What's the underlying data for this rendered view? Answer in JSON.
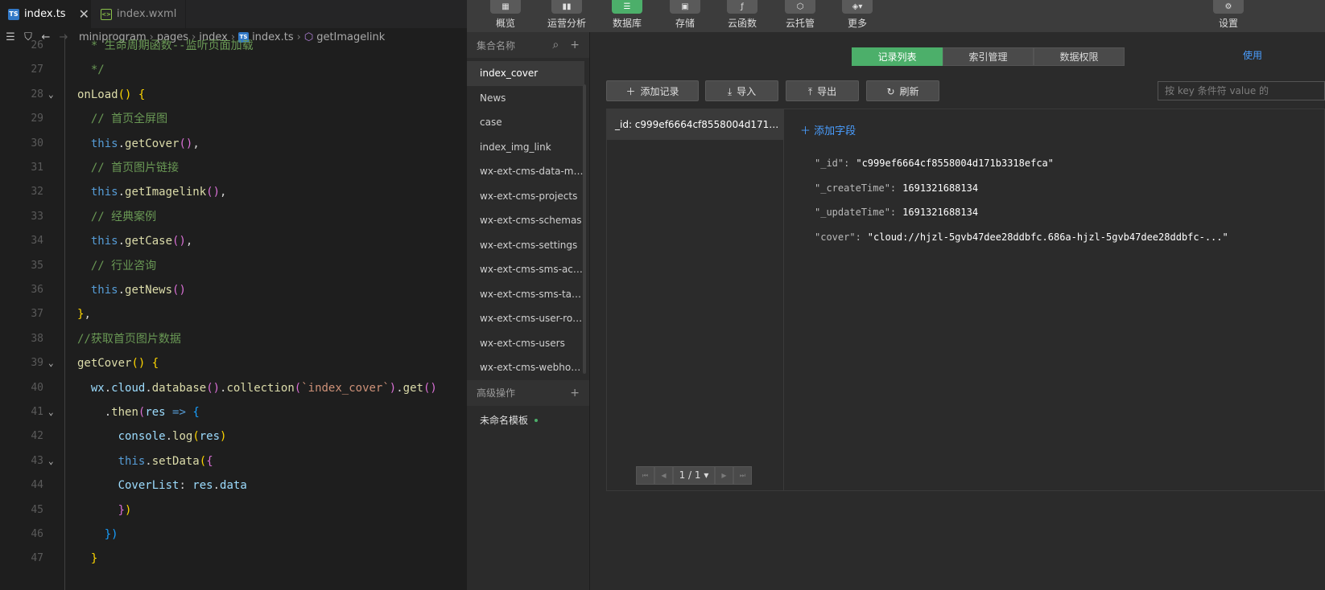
{
  "editor": {
    "tabs": [
      {
        "label": "index.ts",
        "close": "✕",
        "badge": "TS"
      },
      {
        "label": "index.wxml",
        "badge": "<>"
      }
    ],
    "breadcrumb": {
      "items": [
        "miniprogram",
        "pages",
        "index",
        "index.ts",
        "getImagelink"
      ]
    },
    "lines": [
      {
        "n": "26",
        "t": [
          [
            "  * 生命周期函数--监听页面加载",
            "cm"
          ]
        ]
      },
      {
        "n": "27",
        "t": [
          [
            "  */",
            "cm"
          ]
        ]
      },
      {
        "n": "28",
        "t": [
          [
            "onLoad",
            "fn"
          ],
          [
            "() ",
            "br1"
          ],
          [
            "{",
            "br1"
          ]
        ]
      },
      {
        "n": "29",
        "t": [
          [
            "  // 首页全屏图",
            "cm"
          ]
        ]
      },
      {
        "n": "30",
        "t": [
          [
            "  this",
            "kw"
          ],
          [
            ".",
            "pu"
          ],
          [
            "getCover",
            "fn"
          ],
          [
            "()",
            "br2"
          ],
          [
            ",",
            "pu"
          ]
        ]
      },
      {
        "n": "31",
        "t": [
          [
            "  // 首页图片链接",
            "cm"
          ]
        ]
      },
      {
        "n": "32",
        "t": [
          [
            "  this",
            "kw"
          ],
          [
            ".",
            "pu"
          ],
          [
            "getImagelink",
            "fn"
          ],
          [
            "()",
            "br2"
          ],
          [
            ",",
            "pu"
          ]
        ]
      },
      {
        "n": "33",
        "t": [
          [
            "  // 经典案例",
            "cm"
          ]
        ]
      },
      {
        "n": "34",
        "t": [
          [
            "  this",
            "kw"
          ],
          [
            ".",
            "pu"
          ],
          [
            "getCase",
            "fn"
          ],
          [
            "()",
            "br2"
          ],
          [
            ",",
            "pu"
          ]
        ]
      },
      {
        "n": "35",
        "t": [
          [
            "  // 行业咨询",
            "cm"
          ]
        ]
      },
      {
        "n": "36",
        "t": [
          [
            "  this",
            "kw"
          ],
          [
            ".",
            "pu"
          ],
          [
            "getNews",
            "fn"
          ],
          [
            "()",
            "br2"
          ]
        ]
      },
      {
        "n": "37",
        "t": [
          [
            "}",
            "br1"
          ],
          [
            ",",
            "pu"
          ]
        ]
      },
      {
        "n": "38",
        "t": [
          [
            "//获取首页图片数据",
            "cm"
          ]
        ]
      },
      {
        "n": "39",
        "t": [
          [
            "getCover",
            "fn"
          ],
          [
            "() ",
            "br1"
          ],
          [
            "{",
            "br1"
          ]
        ]
      },
      {
        "n": "40",
        "t": [
          [
            "  wx",
            "pr"
          ],
          [
            ".",
            "pu"
          ],
          [
            "cloud",
            "pr"
          ],
          [
            ".",
            "pu"
          ],
          [
            "database",
            "fn"
          ],
          [
            "()",
            "br2"
          ],
          [
            ".",
            "pu"
          ],
          [
            "collection",
            "fn"
          ],
          [
            "(",
            "br2"
          ],
          [
            "`index_cover`",
            "str"
          ],
          [
            ")",
            "br2"
          ],
          [
            ".",
            "pu"
          ],
          [
            "get",
            "fn"
          ],
          [
            "()",
            "br2"
          ]
        ]
      },
      {
        "n": "41",
        "t": [
          [
            "    .",
            "pu"
          ],
          [
            "then",
            "fn"
          ],
          [
            "(",
            "br2"
          ],
          [
            "res",
            "pr"
          ],
          [
            " => ",
            "kw"
          ],
          [
            "{",
            "br3"
          ]
        ]
      },
      {
        "n": "42",
        "t": [
          [
            "      console",
            "pr"
          ],
          [
            ".",
            "pu"
          ],
          [
            "log",
            "fn"
          ],
          [
            "(",
            "br1"
          ],
          [
            "res",
            "pr"
          ],
          [
            ")",
            "br1"
          ]
        ]
      },
      {
        "n": "43",
        "t": [
          [
            "      this",
            "kw"
          ],
          [
            ".",
            "pu"
          ],
          [
            "setData",
            "fn"
          ],
          [
            "(",
            "br1"
          ],
          [
            "{",
            "br2"
          ]
        ]
      },
      {
        "n": "44",
        "t": [
          [
            "      CoverList",
            "pr"
          ],
          [
            ": ",
            "pu"
          ],
          [
            "res",
            "pr"
          ],
          [
            ".",
            "pu"
          ],
          [
            "data",
            "pr"
          ]
        ]
      },
      {
        "n": "45",
        "t": [
          [
            "      }",
            "br2"
          ],
          [
            ")",
            "br1"
          ]
        ]
      },
      {
        "n": "46",
        "t": [
          [
            "    })",
            "br3"
          ]
        ]
      },
      {
        "n": "47",
        "t": [
          [
            "  }",
            "br1"
          ]
        ]
      }
    ]
  },
  "db": {
    "topbar": [
      {
        "label": "概览",
        "icon": "▦"
      },
      {
        "label": "运营分析",
        "icon": "▮▮"
      },
      {
        "label": "数据库",
        "icon": "☰"
      },
      {
        "label": "存储",
        "icon": "▣"
      },
      {
        "label": "云函数",
        "icon": "ƒ"
      },
      {
        "label": "云托管",
        "icon": "⬡"
      },
      {
        "label": "更多",
        "icon": "◈▾"
      },
      {
        "label": "设置",
        "icon": "⚙"
      }
    ],
    "sidebar": {
      "header": "集合名称",
      "collections": [
        "index_cover",
        "News",
        "case",
        "index_img_link",
        "wx-ext-cms-data-mig...",
        "wx-ext-cms-projects",
        "wx-ext-cms-schemas",
        "wx-ext-cms-settings",
        "wx-ext-cms-sms-activ...",
        "wx-ext-cms-sms-tasks",
        "wx-ext-cms-user-roles",
        "wx-ext-cms-users",
        "wx-ext-cms-webhook..."
      ],
      "advanced_header": "高级操作",
      "templates": [
        "未命名模板"
      ]
    },
    "tabs": [
      "记录列表",
      "索引管理",
      "数据权限"
    ],
    "use_link": "使用",
    "actions": {
      "add": "添加记录",
      "import": "导入",
      "export": "导出",
      "refresh": "刷新"
    },
    "search_placeholder": "按 key 条件符 value 的",
    "records": [
      "_id: c999ef6664cf8558004d171b33..."
    ],
    "pager": {
      "page": "1 / 1"
    },
    "detail": {
      "add_field": "添加字段",
      "fields": [
        {
          "key": "\"_id\":",
          "value": "\"c999ef6664cf8558004d171b3318efca\""
        },
        {
          "key": "\"_createTime\":",
          "value": "1691321688134"
        },
        {
          "key": "\"_updateTime\":",
          "value": "1691321688134"
        },
        {
          "key": "\"cover\":",
          "value": "\"cloud://hjzl-5gvb47dee28ddbfc.686a-hjzl-5gvb47dee28ddbfc-...\""
        }
      ]
    }
  }
}
